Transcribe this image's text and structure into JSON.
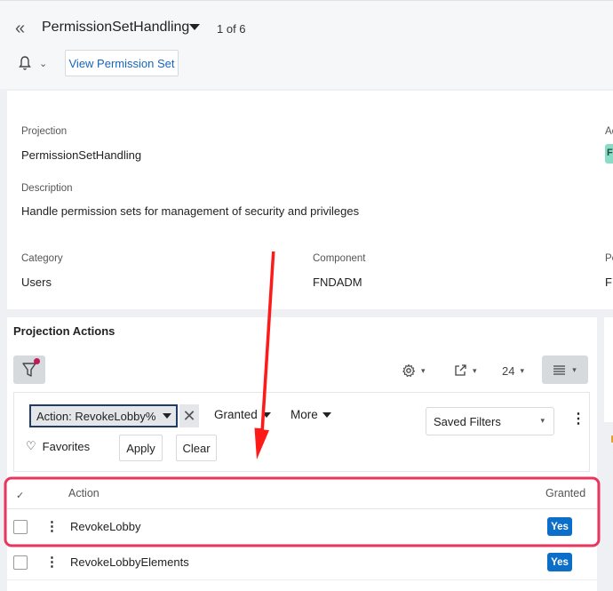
{
  "header": {
    "back_icon": "double-chevron-left-icon",
    "title": "PermissionSetHandling",
    "record_count": "1 of 6",
    "notification_icon": "bell-icon",
    "view_button": "View Permission Set"
  },
  "details": {
    "projection_label": "Projection",
    "projection_value": "PermissionSetHandling",
    "description_label": "Description",
    "description_value": "Handle permission sets for management of security and privileges",
    "category_label": "Category",
    "category_value": "Users",
    "component_label": "Component",
    "component_value": "FNDADM",
    "cut_label_1": "Ac",
    "cut_badge_1": "F",
    "cut_label_2": "Pe",
    "cut_value_2": "FI"
  },
  "projection_actions": {
    "title": "Projection Actions",
    "page_size": "24",
    "active_filter": "Action: RevokeLobby%",
    "granted_dropdown": "Granted",
    "more_dropdown": "More",
    "saved_filters": "Saved Filters",
    "favorites": "Favorites",
    "apply": "Apply",
    "clear": "Clear",
    "columns": {
      "action": "Action",
      "granted": "Granted"
    },
    "rows": [
      {
        "action": "RevokeLobby",
        "granted": "Yes"
      },
      {
        "action": "RevokeLobbyElements",
        "granted": "Yes"
      }
    ]
  },
  "colors": {
    "accent": "#1565c0",
    "yes_badge": "#0b6ec8",
    "annotation": "#e8365f",
    "arrow": "#ff1a1a",
    "chip_border": "#1f3b66"
  }
}
